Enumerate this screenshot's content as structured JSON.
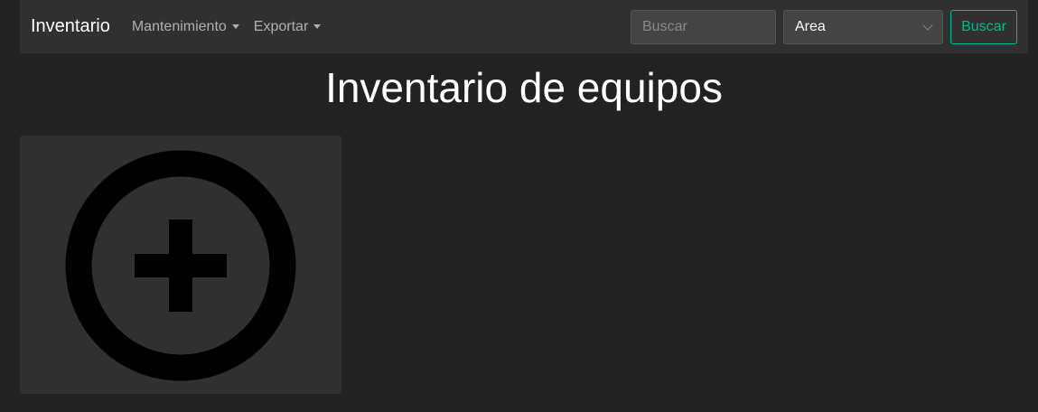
{
  "navbar": {
    "brand": "Inventario",
    "menu": [
      {
        "label": "Mantenimiento"
      },
      {
        "label": "Exportar"
      }
    ],
    "search": {
      "placeholder": "Buscar",
      "value": ""
    },
    "area_select": {
      "selected": "Area"
    },
    "search_button_label": "Buscar"
  },
  "main": {
    "title": "Inventario de equipos",
    "add_card_icon": "plus-circle-icon"
  },
  "colors": {
    "background": "#222222",
    "navbar": "#303030",
    "accent": "#00bc8c",
    "card": "#303030",
    "icon": "#000000"
  }
}
